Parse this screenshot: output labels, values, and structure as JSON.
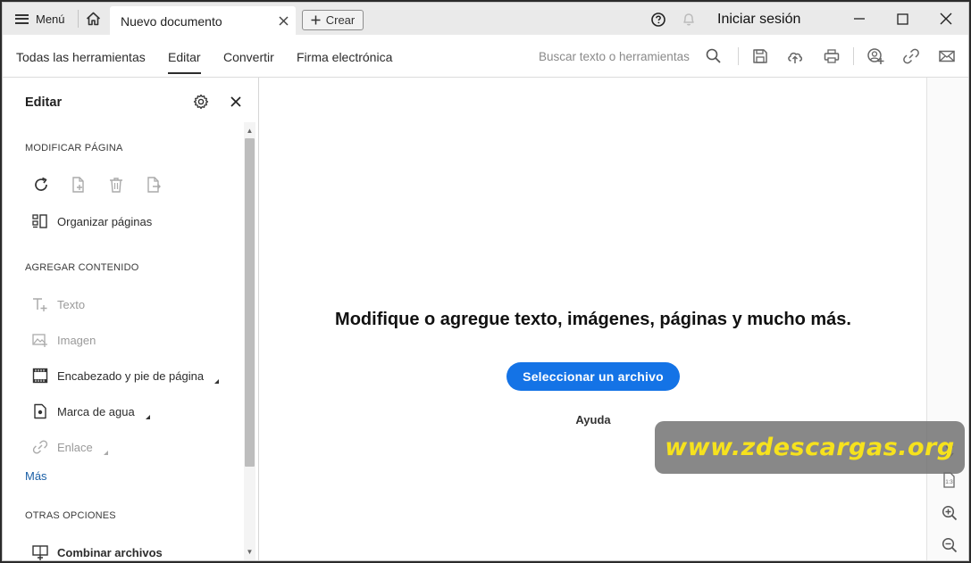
{
  "titlebar": {
    "menu_label": "Menú",
    "tab_title": "Nuevo documento",
    "create_label": "Crear",
    "signin_label": "Iniciar sesión"
  },
  "toolbar": {
    "tabs": [
      {
        "label": "Todas las herramientas"
      },
      {
        "label": "Editar",
        "active": true
      },
      {
        "label": "Convertir"
      },
      {
        "label": "Firma electrónica"
      }
    ],
    "search_placeholder": "Buscar texto o herramientas",
    "icons": [
      "search-icon",
      "save-icon",
      "upload-cloud-icon",
      "print-icon",
      "add-user-icon",
      "link-icon",
      "mail-icon"
    ]
  },
  "panel": {
    "title": "Editar",
    "section_modify": "MODIFICAR PÁGINA",
    "organize_label": "Organizar páginas",
    "section_add": "AGREGAR CONTENIDO",
    "items": [
      {
        "label": "Texto",
        "enabled": false
      },
      {
        "label": "Imagen",
        "enabled": false
      },
      {
        "label": "Encabezado y pie de página",
        "enabled": true
      },
      {
        "label": "Marca de agua",
        "enabled": true
      },
      {
        "label": "Enlace",
        "enabled": false
      }
    ],
    "more_label": "Más",
    "section_other": "OTRAS OPCIONES",
    "combine_label": "Combinar archivos"
  },
  "main": {
    "message": "Modifique o agregue texto, imágenes, páginas y mucho más.",
    "select_button": "Seleccionar un archivo",
    "help_label": "Ayuda"
  },
  "watermark": {
    "text": "www.zdescargas.org"
  },
  "colors": {
    "accent": "#1473e6",
    "link": "#1a5fa6",
    "watermark_text": "#f6e21d"
  }
}
